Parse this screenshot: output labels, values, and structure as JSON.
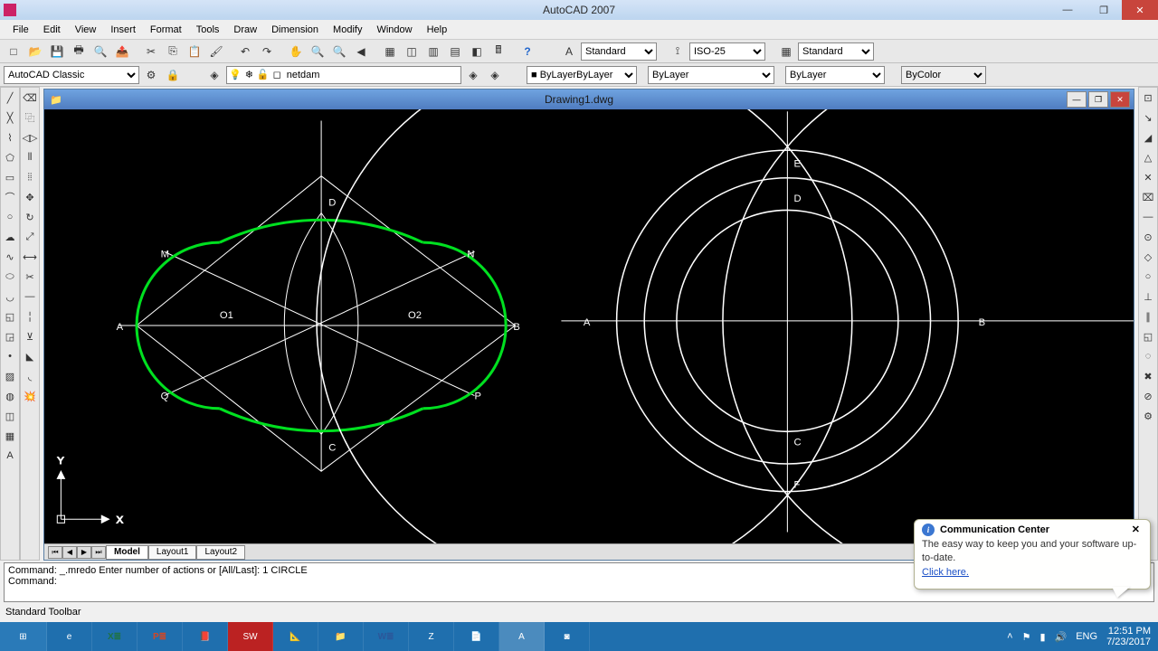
{
  "app": {
    "title": "AutoCAD 2007"
  },
  "menu": [
    "File",
    "Edit",
    "View",
    "Insert",
    "Format",
    "Tools",
    "Draw",
    "Dimension",
    "Modify",
    "Window",
    "Help"
  ],
  "toolbar1": {
    "workspace_combo": "AutoCAD Classic",
    "style_combo": "Standard",
    "dim_combo": "ISO-25",
    "table_combo": "Standard",
    "layer_field": "netdam"
  },
  "toolbar2": {
    "linetype": "ByLayer",
    "lineweight": "ByLayer",
    "lineweight2": "ByLayer",
    "bycolor": "ByColor"
  },
  "drawing_window": {
    "title": "Drawing1.dwg"
  },
  "tabs": [
    "Model",
    "Layout1",
    "Layout2"
  ],
  "labels_left": {
    "A": "A",
    "B": "B",
    "C": "C",
    "D": "D",
    "M": "M",
    "N": "N",
    "P": "P",
    "Q": "Q",
    "O1": "O1",
    "O2": "O2"
  },
  "labels_right": {
    "A": "A",
    "B": "B",
    "C": "C",
    "D": "D",
    "E": "E",
    "F": "F"
  },
  "ucs": {
    "x": "X",
    "y": "Y"
  },
  "cmd": {
    "line1": "Command: _.mredo Enter number of actions or [All/Last]: 1 CIRCLE",
    "line2": "Command:"
  },
  "status": {
    "text": "Standard Toolbar"
  },
  "comm": {
    "title": "Communication Center",
    "body": "The easy way to keep you and your software up-to-date.",
    "link": "Click here."
  },
  "tray": {
    "lang": "ENG",
    "time": "12:51 PM",
    "date": "7/23/2017"
  }
}
